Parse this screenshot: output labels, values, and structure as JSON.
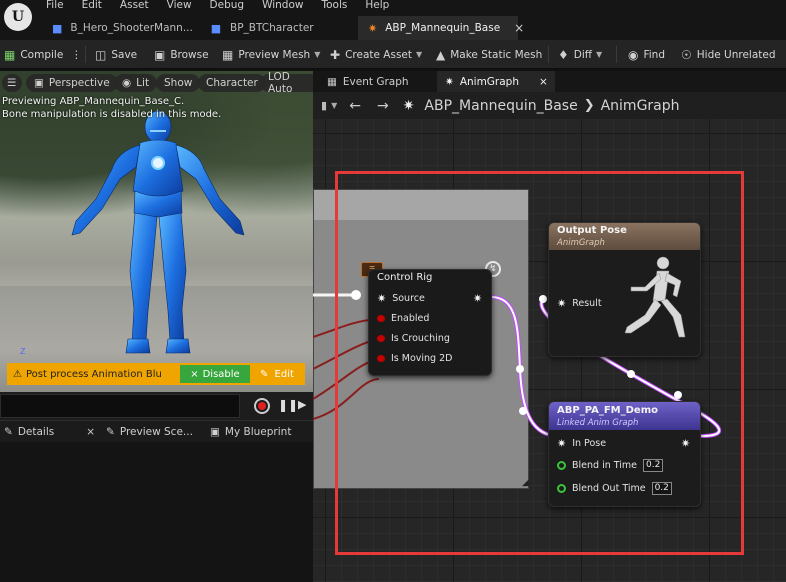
{
  "menu": [
    "File",
    "Edit",
    "Asset",
    "View",
    "Debug",
    "Window",
    "Tools",
    "Help"
  ],
  "tabs": [
    {
      "label": "B_Hero_ShooterMann...",
      "icon": "person-icon"
    },
    {
      "label": "BP_BTCharacter",
      "icon": "person-icon"
    },
    {
      "label": "ABP_Mannequin_Base",
      "icon": "running-man-icon",
      "active": true
    }
  ],
  "toolbar": {
    "compile": "Compile",
    "save": "Save",
    "browse": "Browse",
    "preview_mesh": "Preview Mesh",
    "create_asset": "Create Asset",
    "make_static_mesh": "Make Static Mesh",
    "diff": "Diff",
    "find": "Find",
    "hide_unrelated": "Hide Unrelated"
  },
  "viewport": {
    "buttons": [
      "Perspective",
      "Lit",
      "Show",
      "Character",
      "LOD Auto"
    ],
    "preview_msg": "Previewing ABP_Mannequin_Base_C.",
    "bone_msg": "Bone manipulation is disabled in this mode.",
    "warning": "Post process Animation Blu",
    "disable": "Disable",
    "edit": "Edit",
    "axis": "Z"
  },
  "left_tabs": [
    "Details",
    "Preview Sce...",
    "My Blueprint"
  ],
  "graph_tabs": [
    "Event Graph",
    "AnimGraph"
  ],
  "breadcrumb": {
    "root": "ABP_Mannequin_Base",
    "child": "AnimGraph"
  },
  "control_rig": {
    "title": "Control Rig",
    "pins": [
      "Source",
      "Enabled",
      "Is Crouching",
      "Is Moving 2D"
    ]
  },
  "output_pose": {
    "title": "Output Pose",
    "subtitle": "AnimGraph",
    "pin": "Result"
  },
  "linked": {
    "title": "ABP_PA_FM_Demo",
    "subtitle": "Linked Anim Graph",
    "pins": [
      {
        "label": "In Pose"
      },
      {
        "label": "Blend in Time",
        "value": "0.2"
      },
      {
        "label": "Blend Out Time",
        "value": "0.2"
      }
    ]
  },
  "colors": {
    "accent": "#f0a400",
    "selection": "#e63a3a",
    "disable": "#37a63d",
    "linked_header": "#5b4fb4",
    "output_header": "#7a6450"
  }
}
